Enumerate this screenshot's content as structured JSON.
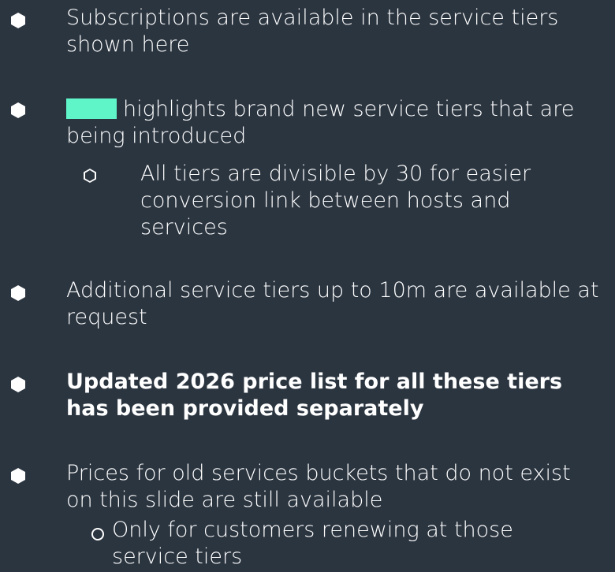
{
  "bullets": [
    {
      "text": "Subscriptions are available in the service tiers shown here"
    },
    {
      "text": "highlights brand new service tiers that are being introduced",
      "swatch_color": "#5ff5c8"
    },
    {
      "text": "Additional service tiers up to 10m are available at request"
    },
    {
      "text": "Updated 2026 price list for all these tiers has been provided separately"
    },
    {
      "text": "Prices for old services buckets that do not exist on this slide are still available"
    }
  ],
  "sub_bullets": [
    {
      "text": "All tiers are divisible by 30 for easier conversion link between hosts and services"
    },
    {
      "text": "Only for customers renewing at those service tiers"
    }
  ],
  "colors": {
    "background": "#2b3540",
    "text": "#ffffff",
    "highlight": "#5ff5c8"
  }
}
